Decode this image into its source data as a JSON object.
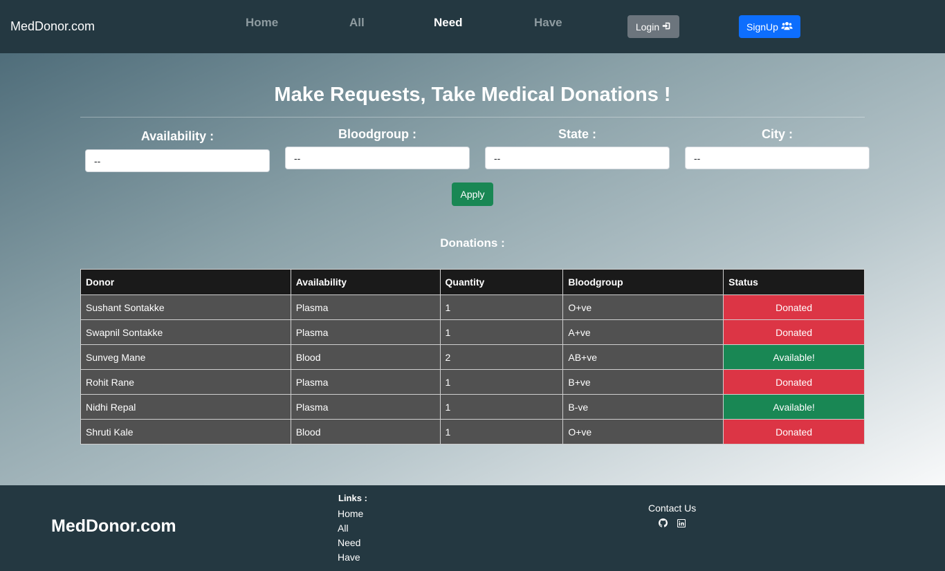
{
  "navbar": {
    "brand": "MedDonor.com",
    "links": [
      {
        "label": "Home",
        "active": false
      },
      {
        "label": "All",
        "active": false
      },
      {
        "label": "Need",
        "active": true
      },
      {
        "label": "Have",
        "active": false
      }
    ],
    "login_label": "Login",
    "signup_label": "SignUp"
  },
  "main": {
    "title": "Make Requests, Take Medical Donations !",
    "filters": [
      {
        "label": "Availability :",
        "value": "--"
      },
      {
        "label": "Bloodgroup :",
        "value": "--"
      },
      {
        "label": "State :",
        "value": "--"
      },
      {
        "label": "City :",
        "value": "--"
      }
    ],
    "apply_label": "Apply",
    "section_title": "Donations :"
  },
  "table": {
    "headers": [
      "Donor",
      "Availability",
      "Quantity",
      "Bloodgroup",
      "Status"
    ],
    "rows": [
      {
        "donor": "Sushant Sontakke",
        "availability": "Plasma",
        "quantity": "1",
        "bloodgroup": "O+ve",
        "status": "Donated"
      },
      {
        "donor": "Swapnil Sontakke",
        "availability": "Plasma",
        "quantity": "1",
        "bloodgroup": "A+ve",
        "status": "Donated"
      },
      {
        "donor": "Sunveg Mane",
        "availability": "Blood",
        "quantity": "2",
        "bloodgroup": "AB+ve",
        "status": "Available!"
      },
      {
        "donor": "Rohit Rane",
        "availability": "Plasma",
        "quantity": "1",
        "bloodgroup": "B+ve",
        "status": "Donated"
      },
      {
        "donor": "Nidhi Repal",
        "availability": "Plasma",
        "quantity": "1",
        "bloodgroup": "B-ve",
        "status": "Available!"
      },
      {
        "donor": "Shruti Kale",
        "availability": "Blood",
        "quantity": "1",
        "bloodgroup": "O+ve",
        "status": "Donated"
      }
    ]
  },
  "footer": {
    "brand": "MedDonor.com",
    "links_title": "Links :",
    "links": [
      "Home",
      "All",
      "Need",
      "Have"
    ],
    "contact_title": "Contact Us",
    "icons": [
      "github-icon",
      "linkedin-icon"
    ]
  },
  "colors": {
    "navbar_bg": "#243841",
    "donated": "#dc3545",
    "available": "#198754",
    "signup": "#0d6efd",
    "login": "#6c757d"
  }
}
